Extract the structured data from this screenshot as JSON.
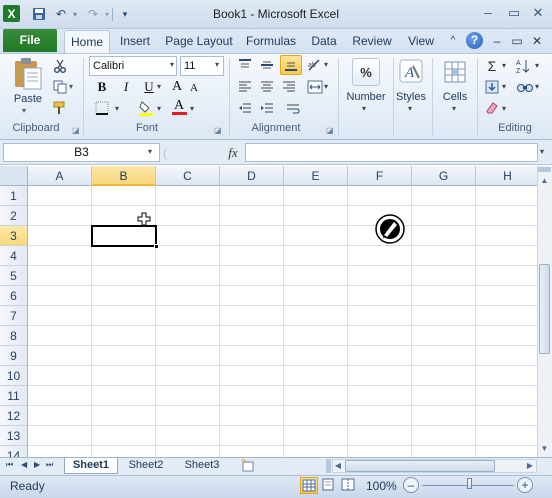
{
  "window": {
    "title": "Book1 - Microsoft Excel",
    "minimize": "–",
    "restore": "▭",
    "close": "✕"
  },
  "qat": {
    "save": "💾",
    "undo": "↶",
    "redo": "↷",
    "customize": "▾",
    "app_icon": "X"
  },
  "tabs": [
    "File",
    "Home",
    "Insert",
    "Page Layout",
    "Formulas",
    "Data",
    "Review",
    "View"
  ],
  "tab_controls": {
    "collapse": "^",
    "help": "?",
    "min": "–",
    "restore": "▭",
    "close": "✕"
  },
  "ribbon": {
    "clipboard": {
      "label": "Clipboard",
      "paste": "Paste"
    },
    "font": {
      "label": "Font",
      "name": "Calibri",
      "size": "11",
      "bold": "B",
      "italic": "I",
      "underline": "U",
      "grow": "A",
      "shrink": "A",
      "font_color": "A"
    },
    "alignment": {
      "label": "Alignment"
    },
    "number": {
      "label": "Number",
      "icon": "%"
    },
    "styles": {
      "label": "Styles"
    },
    "cells": {
      "label": "Cells"
    },
    "editing": {
      "label": "Editing",
      "sum": "Σ"
    }
  },
  "formula_bar": {
    "name_box": "B3",
    "fx": "fx",
    "value": ""
  },
  "columns": [
    "A",
    "B",
    "C",
    "D",
    "E",
    "F",
    "G",
    "H"
  ],
  "rows": [
    "1",
    "2",
    "3",
    "4",
    "5",
    "6",
    "7",
    "8",
    "9",
    "10",
    "11",
    "12",
    "13",
    "14"
  ],
  "selected": {
    "column": "B",
    "row": "3"
  },
  "sheets": [
    "Sheet1",
    "Sheet2",
    "Sheet3"
  ],
  "active_sheet": "Sheet1",
  "status": {
    "ready": "Ready",
    "zoom": "100%",
    "zoom_minus": "–",
    "zoom_plus": "+"
  }
}
